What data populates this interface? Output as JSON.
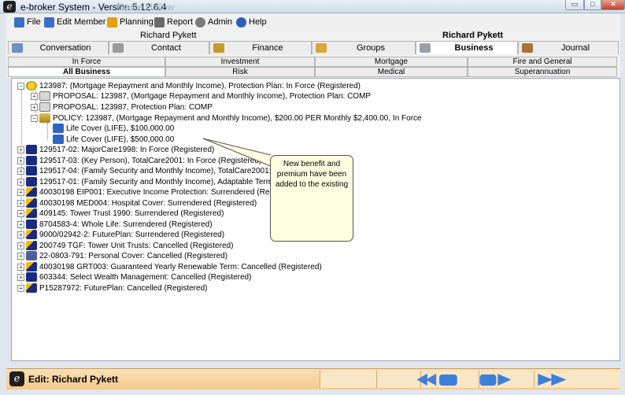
{
  "window": {
    "title": "e-broker System - Version 5.12.6.4",
    "ghost_title": "- Game Hollow",
    "minimize_glyph": "▭",
    "maximize_glyph": "□",
    "close_glyph": "✕",
    "app_icon_glyph": "e"
  },
  "menu": [
    {
      "label": "File",
      "icon": "file-icon",
      "color": "#3b6fc7"
    },
    {
      "label": "Edit Member",
      "icon": "edit-member-icon",
      "color": "#3b6fc7"
    },
    {
      "label": "Planning",
      "icon": "planning-icon",
      "color": "#e0a010"
    },
    {
      "label": "Report",
      "icon": "report-icon",
      "color": "#6b6b6b"
    },
    {
      "label": "Admin",
      "icon": "admin-gear-icon",
      "color": "#7a7a7a"
    },
    {
      "label": "Help",
      "icon": "help-icon",
      "color": "#2a5fb5"
    }
  ],
  "client_left": "Richard Pykett",
  "client_right": "Richard Pykett",
  "tabs_row1": [
    {
      "label": "Conversation",
      "icon": "conversation-icon"
    },
    {
      "label": "Contact",
      "icon": "contact-icon"
    },
    {
      "label": "Finance",
      "icon": "finance-icon"
    },
    {
      "label": "Groups",
      "icon": "groups-icon"
    },
    {
      "label": "Business",
      "icon": "business-icon",
      "active": true
    },
    {
      "label": "Journal",
      "icon": "journal-icon"
    }
  ],
  "tabs_row2": [
    {
      "label": "In Force"
    },
    {
      "label": "Investment"
    },
    {
      "label": "Mortgage"
    },
    {
      "label": "Fire and General"
    }
  ],
  "tabs_row3": [
    {
      "label": "All Business",
      "active": true
    },
    {
      "label": "Risk"
    },
    {
      "label": "Medical"
    },
    {
      "label": "Superannuation"
    }
  ],
  "tree": [
    {
      "text": "123987: (Mortgage Repayment and Monthly Income), Protection Plan: In Force (Registered)",
      "icon": "client",
      "expander": "−",
      "level": 0
    },
    {
      "text": "PROPOSAL: 123987, (Mortgage Repayment and Monthly Income), Protection Plan: COMP",
      "icon": "proposal",
      "expander": "+",
      "level": 1
    },
    {
      "text": "PROPOSAL: 123987, Protection Plan: COMP",
      "icon": "proposal",
      "expander": "+",
      "level": 1
    },
    {
      "text": "POLICY: 123987, (Mortgage Repayment and Monthly Income), $200.00 PER Monthly $2,400.00, In Force",
      "icon": "policy-open",
      "expander": "−",
      "level": 1
    },
    {
      "text": "Life Cover (LIFE), $100,000.00",
      "icon": "benefit",
      "expander": "",
      "level": 2
    },
    {
      "text": "Life Cover (LIFE), $500,000.00",
      "icon": "benefit",
      "expander": "",
      "level": 2
    },
    {
      "text": "129517-02: MajorCare1998: In Force (Registered)",
      "icon": "policy",
      "expander": "+",
      "level": 0
    },
    {
      "text": "129517-03: (Key Person), TotalCare2001: In Force (Registered)",
      "icon": "policy",
      "expander": "+",
      "level": 0
    },
    {
      "text": "129517-04: (Family Security and Monthly Income), TotalCare2001: In Force (Registered)",
      "icon": "policy",
      "expander": "+",
      "level": 0
    },
    {
      "text": "129517-01: (Family Security and Monthly Income), Adaptable Term: Lapsed (Registered)",
      "icon": "policy",
      "expander": "+",
      "level": 0
    },
    {
      "text": "40030198 EIP001: Executive Income Protection: Surrendered (Registered)",
      "icon": "term",
      "expander": "+",
      "level": 0
    },
    {
      "text": "40030198 MED004: Hospital Cover: Surrendered (Registered)",
      "icon": "term",
      "expander": "+",
      "level": 0
    },
    {
      "text": "409145: Tower Trust 1990: Surrendered (Registered)",
      "icon": "term",
      "expander": "+",
      "level": 0
    },
    {
      "text": "8704583-4: Whole Life: Surrendered (Registered)",
      "icon": "policy",
      "expander": "+",
      "level": 0
    },
    {
      "text": "9000/02942-2: FuturePlan: Surrendered (Registered)",
      "icon": "wealth",
      "expander": "+",
      "level": 0
    },
    {
      "text": "200749 TGF: Tower Unit Trusts: Cancelled (Registered)",
      "icon": "term",
      "expander": "+",
      "level": 0
    },
    {
      "text": "22-0803-791: Personal Cover: Cancelled (Registered)",
      "icon": "personal",
      "expander": "+",
      "level": 0
    },
    {
      "text": "40030198 GRT003: Guaranteed Yearly Renewable Term: Cancelled (Registered)",
      "icon": "term",
      "expander": "+",
      "level": 0
    },
    {
      "text": "603344: Select Wealth Management: Cancelled (Registered)",
      "icon": "policy",
      "expander": "+",
      "level": 0
    },
    {
      "text": "P15287972: FuturePlan: Cancelled (Registered)",
      "icon": "wealth",
      "expander": "+",
      "level": 0
    }
  ],
  "callout": {
    "text": "New benefit and premium have been added to the existing"
  },
  "status": {
    "label": "Edit:",
    "name": "Richard Pykett",
    "text": "Edit: Richard Pykett",
    "icon_glyph": "e"
  },
  "nav": [
    {
      "name": "first-record-button"
    },
    {
      "name": "previous-record-button"
    },
    {
      "name": "next-record-button"
    },
    {
      "name": "last-record-button"
    }
  ],
  "colors": {
    "accent": "#1a2a80",
    "status_bar": "#f5c98a",
    "nav_arrow": "#3d7fd9"
  }
}
